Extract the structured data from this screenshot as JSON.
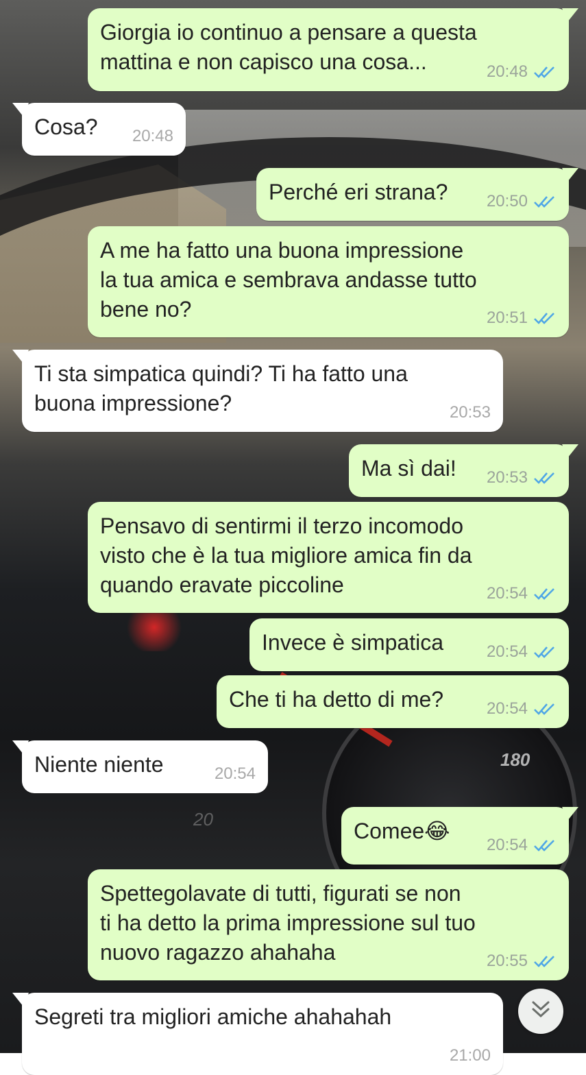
{
  "messages": [
    {
      "direction": "out",
      "text": "Giorgia io continuo a pensare a questa\nmattina e non capisco una cosa...",
      "time": "20:48",
      "status": "read"
    },
    {
      "direction": "in",
      "text": "Cosa?",
      "time": "20:48"
    },
    {
      "direction": "out",
      "text": "Perché eri strana?",
      "time": "20:50",
      "status": "read"
    },
    {
      "direction": "out",
      "text": "A me ha fatto una buona impressione\nla tua amica e sembrava andasse tutto\nbene no?",
      "time": "20:51",
      "status": "read"
    },
    {
      "direction": "in",
      "text": "Ti sta simpatica quindi? Ti ha fatto una\nbuona impressione?",
      "time": "20:53"
    },
    {
      "direction": "out",
      "text": "Ma sì dai!",
      "time": "20:53",
      "status": "read"
    },
    {
      "direction": "out",
      "text": "Pensavo di sentirmi il terzo incomodo\nvisto che è la tua migliore amica fin da\nquando eravate piccoline",
      "time": "20:54",
      "status": "read"
    },
    {
      "direction": "out",
      "text": "Invece è simpatica",
      "time": "20:54",
      "status": "read"
    },
    {
      "direction": "out",
      "text": "Che ti ha detto di me?",
      "time": "20:54",
      "status": "read"
    },
    {
      "direction": "in",
      "text": "Niente niente",
      "time": "20:54"
    },
    {
      "direction": "out",
      "text": "Comee😂",
      "time": "20:54",
      "status": "read"
    },
    {
      "direction": "out",
      "text": "Spettegolavate di tutti, figurati se non\nti ha detto la prima impressione sul tuo\nnuovo ragazzo ahahaha",
      "time": "20:55",
      "status": "read"
    },
    {
      "direction": "in",
      "text": "Segreti tra migliori amiche ahahahah",
      "time": "21:00"
    }
  ],
  "wallpaper": {
    "speedometer_label": "180",
    "speedometer_label_low": "20"
  },
  "colors": {
    "outgoing_bubble": "#e1fec6",
    "incoming_bubble": "#ffffff",
    "read_tick": "#4fa6e6"
  },
  "icons": {
    "read_receipt": "double-check-icon",
    "scroll_down": "chevron-double-down-icon"
  }
}
